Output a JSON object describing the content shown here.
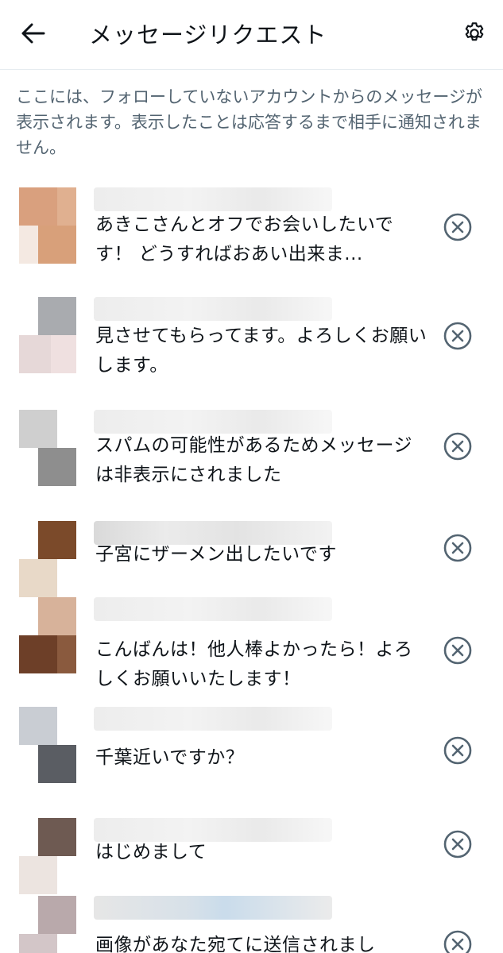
{
  "header": {
    "title": "メッセージリクエスト",
    "back_icon": "arrow-left-icon",
    "settings_icon": "gear-icon"
  },
  "description": "ここには、フォローしていないアカウントからのメッセージが表示されます。表示したことは応答するまで相手に通知されません。",
  "requests": [
    {
      "message": "あきこさんとオフでお会いしたいです！ どうすればおあい出来ま..."
    },
    {
      "message": "見させてもらってます。よろしくお願いします。"
    },
    {
      "message": "スパムの可能性があるためメッセージは非表示にされました"
    },
    {
      "message": "子宮にザーメン出したいです"
    },
    {
      "message": "こんばんは！他人棒よかったら！よろしくお願いいたします！"
    },
    {
      "message": "千葉近いですか？"
    },
    {
      "message": "はじめまして"
    },
    {
      "message": "画像があなた宛てに送信されまし"
    }
  ],
  "colors": {
    "text_primary": "#0f1419",
    "text_secondary": "#536471",
    "divider": "#e6ecf0"
  }
}
